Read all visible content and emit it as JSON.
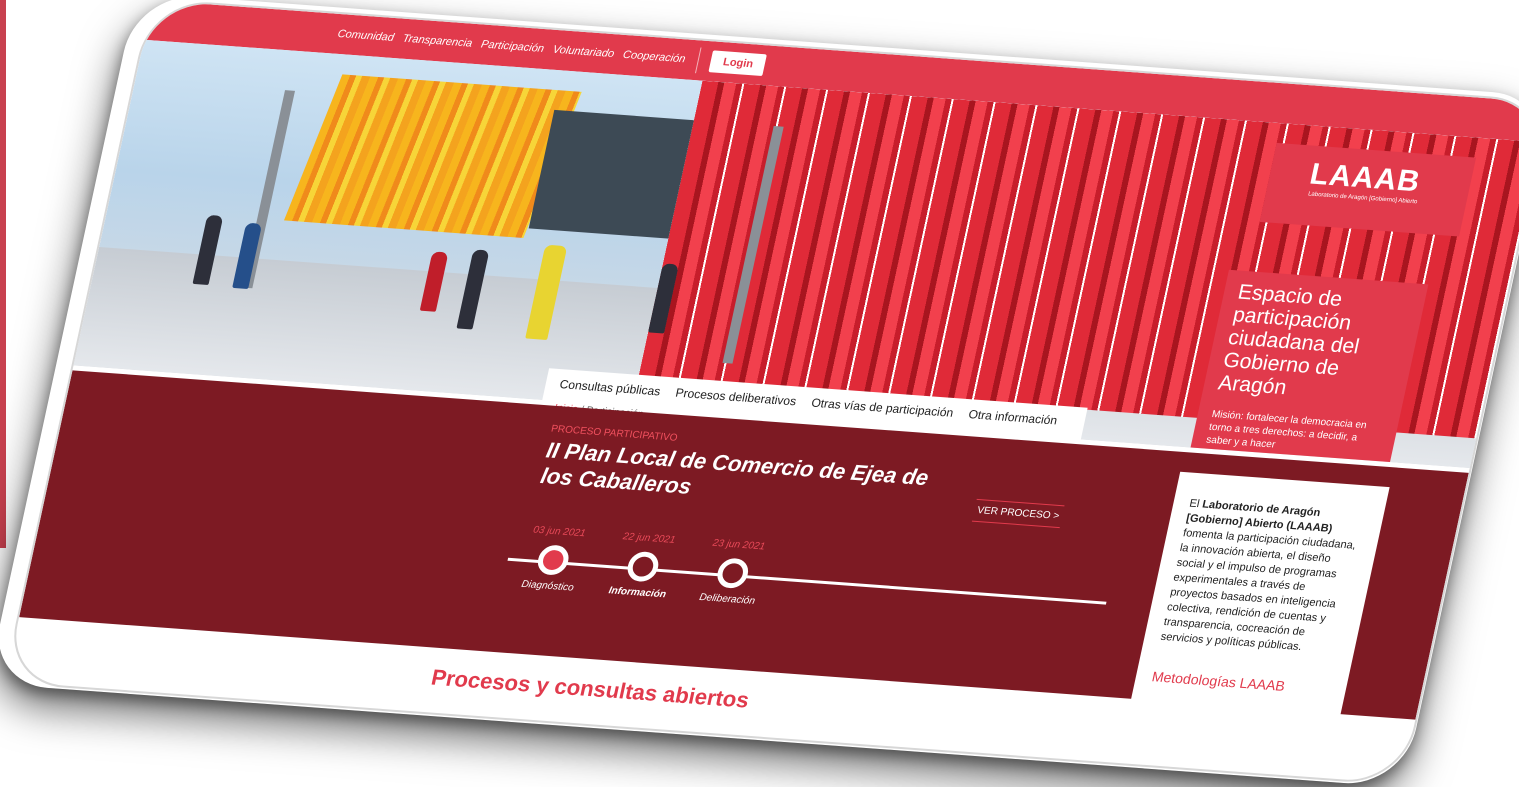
{
  "topnav": {
    "items": [
      "Comunidad",
      "Transparencia",
      "Participación",
      "Voluntariado",
      "Cooperación"
    ],
    "login_label": "Login"
  },
  "hero": {
    "logo_text": "LAAAB",
    "logo_subtitle": "Laboratorio de Aragón [Gobierno] Abierto",
    "space_title": "Espacio de participación ciudadana del Gobierno de Aragón",
    "mission": "Misión: fortalecer la democracia en torno a tres derechos: a decidir, a saber y a hacer"
  },
  "subnav": {
    "tabs": [
      "Consultas públicas",
      "Procesos deliberativos",
      "Otras vías de participación",
      "Otra información"
    ]
  },
  "breadcrumb": {
    "home": "Inicio",
    "separator": "/",
    "current": "Participación"
  },
  "process": {
    "eyebrow": "PROCESO PARTICIPATIVO",
    "title": "II Plan Local de Comercio de Ejea de los Caballeros",
    "button_label": "VER PROCESO >",
    "steps": [
      {
        "date": "03 jun 2021",
        "label": "Diagnóstico"
      },
      {
        "date": "22 jun 2021",
        "label": "Información"
      },
      {
        "date": "23 jun 2021",
        "label": "Deliberación"
      }
    ]
  },
  "about": {
    "intro": "El ",
    "org_name": "Laboratorio de Aragón [Gobierno] Abierto (LAAAB)",
    "body": " fomenta la participación ciudadana, la innovación abierta, el diseño social y el impulso de programas experimentales a través de proyectos basados en inteligencia colectiva, rendición de cuentas y transparencia, cocreación de servicios y políticas públicas.",
    "link": "Metodologías LAAAB"
  },
  "section_title": "Procesos y consultas abiertos",
  "colors": {
    "accent": "#e13a4c",
    "process_bg": "#7d1a23"
  }
}
